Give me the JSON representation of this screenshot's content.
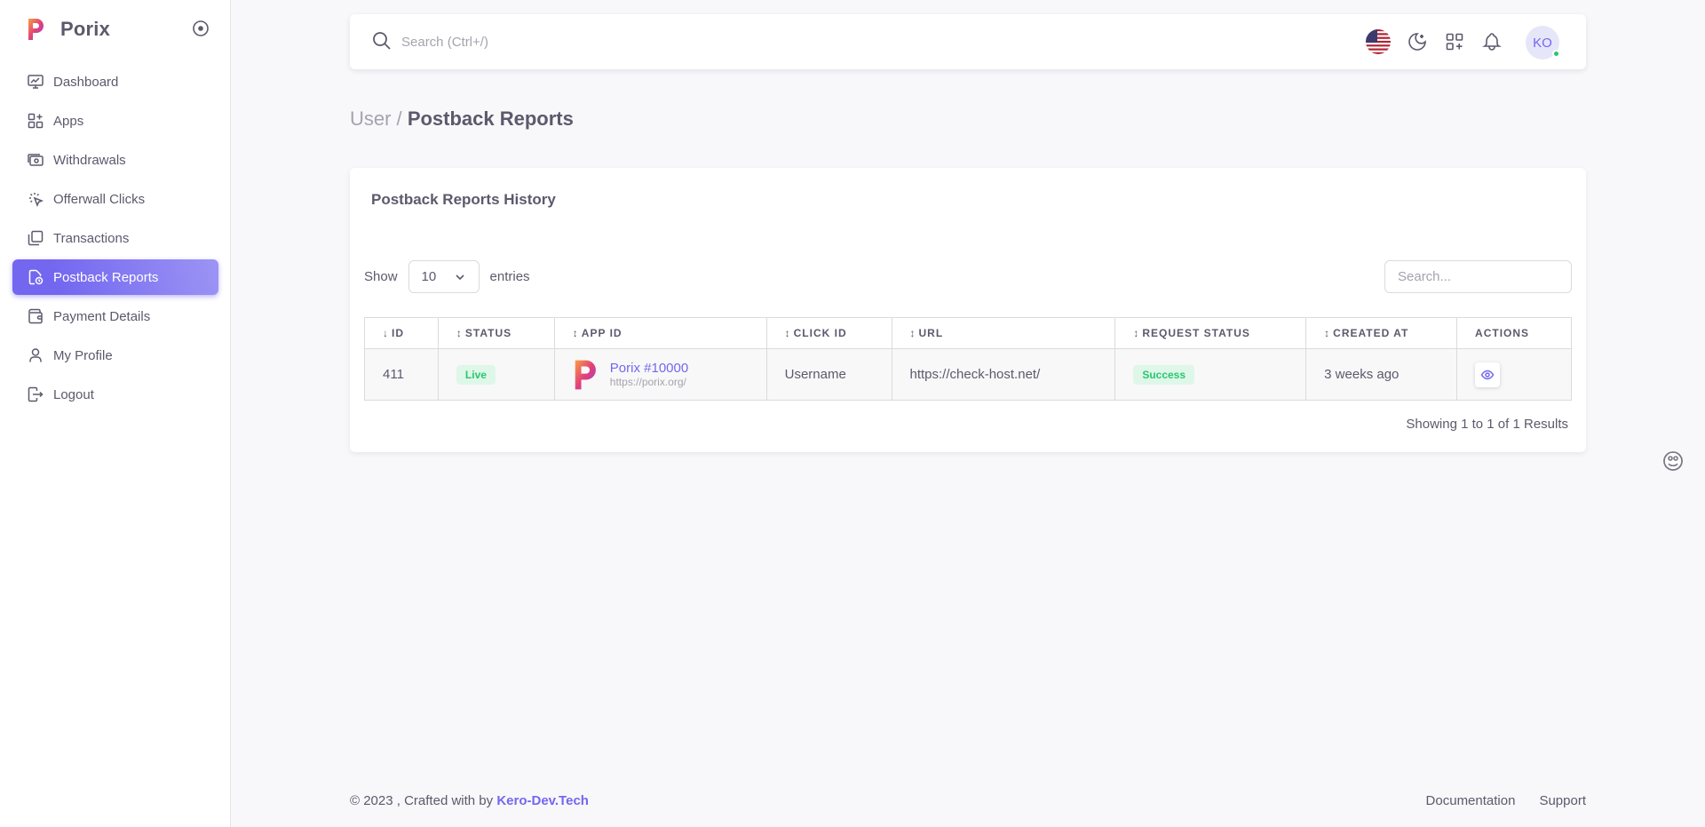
{
  "brand": {
    "name": "Porix",
    "icon": "porix-logo"
  },
  "sidebar": {
    "items": [
      {
        "label": "Dashboard",
        "icon": "dashboard-icon",
        "active": false
      },
      {
        "label": "Apps",
        "icon": "apps-icon",
        "active": false
      },
      {
        "label": "Withdrawals",
        "icon": "withdrawals-icon",
        "active": false
      },
      {
        "label": "Offerwall Clicks",
        "icon": "click-icon",
        "active": false
      },
      {
        "label": "Transactions",
        "icon": "transactions-icon",
        "active": false
      },
      {
        "label": "Postback Reports",
        "icon": "report-icon",
        "active": true
      },
      {
        "label": "Payment Details",
        "icon": "wallet-icon",
        "active": false
      },
      {
        "label": "My Profile",
        "icon": "user-icon",
        "active": false
      },
      {
        "label": "Logout",
        "icon": "logout-icon",
        "active": false
      }
    ]
  },
  "navbar": {
    "search_placeholder": "Search (Ctrl+/)",
    "avatar_initials": "KO"
  },
  "breadcrumb": {
    "parent": "User /",
    "current": "Postback Reports"
  },
  "card": {
    "title": "Postback Reports History",
    "show_label": "Show",
    "entries_label": "entries",
    "length_value": "10",
    "search_placeholder": "Search...",
    "columns": [
      "ID",
      "STATUS",
      "APP ID",
      "CLICK ID",
      "URL",
      "REQUEST STATUS",
      "CREATED AT",
      "ACTIONS"
    ],
    "rows": [
      {
        "id": "411",
        "status": "Live",
        "app_name": "Porix #10000",
        "app_url": "https://porix.org/",
        "click_id": "Username",
        "url": "https://check-host.net/",
        "request_status": "Success",
        "created_at": "3 weeks ago"
      }
    ],
    "info": "Showing 1 to 1 of 1 Results"
  },
  "footer": {
    "copyright": "© 2023 , Crafted with by",
    "author": "Kero-Dev.Tech",
    "links": [
      "Documentation",
      "Support"
    ]
  },
  "colors": {
    "primary": "#7367f0",
    "success": "#28c76f",
    "text": "#5d596c",
    "muted": "#a5a3ae"
  }
}
